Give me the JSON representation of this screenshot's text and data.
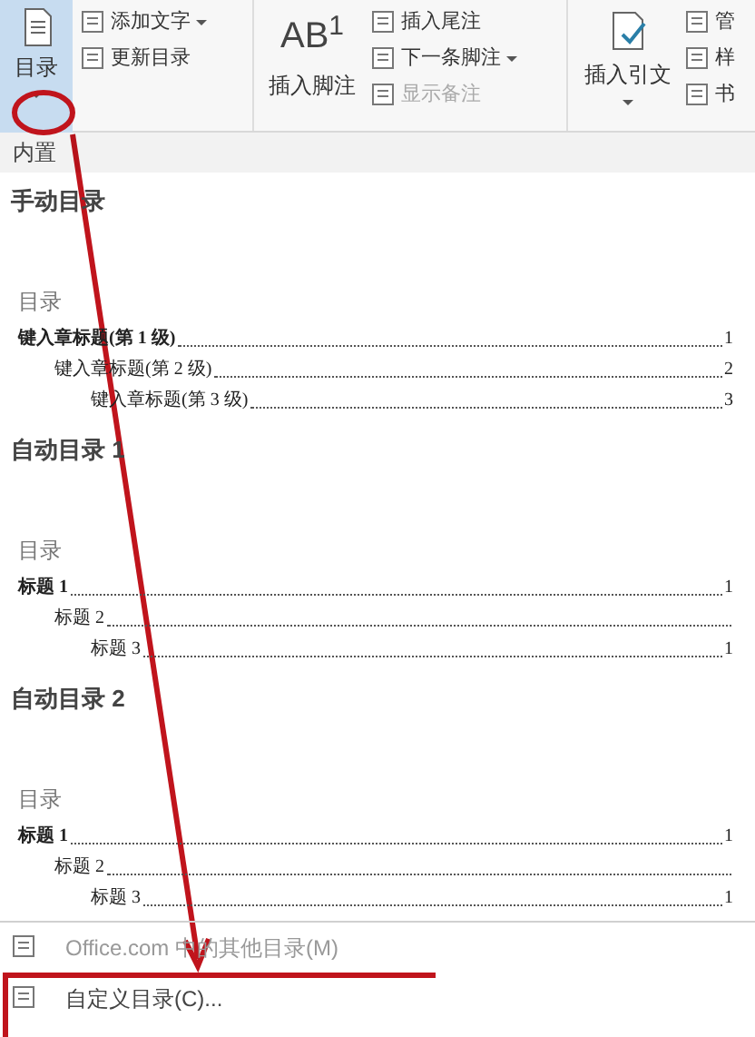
{
  "ribbon": {
    "toc_button": {
      "label": "目录"
    },
    "toc_small": [
      {
        "label": "添加文字",
        "dropdown": true
      },
      {
        "label": "更新目录",
        "dropdown": false
      }
    ],
    "footnote_button": {
      "icon_text": "AB$^{1}$",
      "label": "插入脚注"
    },
    "footnote_small": [
      {
        "label": "插入尾注",
        "dropdown": false,
        "disabled": false
      },
      {
        "label": "下一条脚注",
        "dropdown": true,
        "disabled": false
      },
      {
        "label": "显示备注",
        "dropdown": false,
        "disabled": true
      }
    ],
    "citation_button": {
      "label": "插入引文"
    },
    "citation_small": [
      {
        "label": "管"
      },
      {
        "label": "样"
      },
      {
        "label": "书"
      }
    ]
  },
  "gallery": {
    "section": "内置",
    "entries": [
      {
        "title": "手动目录",
        "heading": "目录",
        "rows": [
          {
            "text": "键入章标题(第 1 级)",
            "page": "1",
            "children": [
              {
                "text": "键入章标题(第 2 级)",
                "page": "2",
                "children": [
                  {
                    "text": "键入章标题(第 3 级)",
                    "page": "3"
                  }
                ]
              }
            ]
          }
        ]
      },
      {
        "title": "自动目录 1",
        "heading": "目录",
        "rows": [
          {
            "text": "标题 1",
            "page": "1",
            "children": [
              {
                "text": "标题 2",
                "children": [
                  {
                    "text": "标题 3",
                    "page": "1"
                  }
                ]
              }
            ]
          }
        ]
      },
      {
        "title": "自动目录 2",
        "heading": "目录",
        "rows": [
          {
            "text": "标题 1",
            "page": "1",
            "children": [
              {
                "text": "标题 2",
                "children": [
                  {
                    "text": "标题 3",
                    "page": "1"
                  }
                ]
              }
            ]
          }
        ]
      }
    ]
  },
  "menu": [
    {
      "label": "Office.com 中的其他目录(M)",
      "disabled": true
    },
    {
      "label": "自定义目录(C)...",
      "disabled": false
    }
  ]
}
